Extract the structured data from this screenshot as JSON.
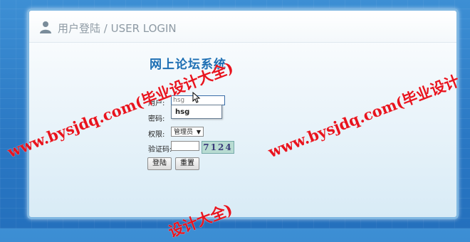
{
  "header": {
    "title": "用户登陆 / USER LOGIN"
  },
  "system_title": "网上论坛系统",
  "form": {
    "username_label": "用户:",
    "username_value": "hsg",
    "autocomplete_suggestion": "hsg",
    "password_label": "密码:",
    "role_label": "权限:",
    "role_selected": "管理员",
    "captcha_label": "验证码:",
    "captcha_value": "",
    "captcha_image_text": "7124",
    "login_button": "登陆",
    "reset_button": "重置"
  },
  "watermarks": {
    "text1": "www.bysjdq.com(毕业设计大全)",
    "text2": "www.bysjdq.com(毕业设计",
    "text3": "设计大全)"
  },
  "colors": {
    "accent": "#1c6eb3",
    "background": "#2a78c4",
    "watermark": "#e8141e"
  }
}
